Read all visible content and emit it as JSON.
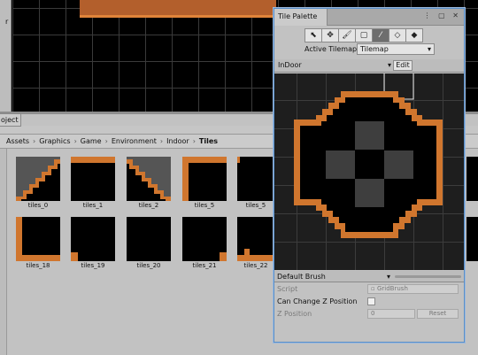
{
  "scene": {
    "left_label": "r"
  },
  "project": {
    "tab_label": "oject",
    "breadcrumb": [
      "Assets",
      "Graphics",
      "Game",
      "Environment",
      "Indoor",
      "Tiles"
    ],
    "tiles": [
      "tiles_0",
      "tiles_1",
      "tiles_2",
      "tiles_4",
      "tiles_5",
      "tiles_18",
      "tiles_19",
      "tiles_20",
      "tiles_21",
      "tiles_22"
    ]
  },
  "palette": {
    "tab_label": "Tile Palette",
    "window_icons": "⋮ ▢ ✕",
    "tools": [
      {
        "icon": "select-icon",
        "glyph": "⬉"
      },
      {
        "icon": "move-icon",
        "glyph": "✥"
      },
      {
        "icon": "paint-brush-icon",
        "glyph": "🖌"
      },
      {
        "icon": "box-fill-icon",
        "glyph": "▢"
      },
      {
        "icon": "picker-icon",
        "glyph": "⁄"
      },
      {
        "icon": "eraser-icon",
        "glyph": "◇"
      },
      {
        "icon": "fill-bucket-icon",
        "glyph": "◆"
      }
    ],
    "active_tool_index": 4,
    "active_tilemap_label": "Active Tilemap",
    "active_tilemap_value": "Tilemap",
    "palette_select": "InDoor",
    "edit_label": "Edit",
    "brush_select": "Default Brush",
    "props": {
      "script_label": "Script",
      "script_value": "GridBrush",
      "can_change_z_label": "Can Change Z Position",
      "z_position_label": "Z Position",
      "z_position_value": "0",
      "reset_label": "Reset"
    },
    "colors": {
      "accent": "#5a8fc8",
      "tile_orange": "#d0762e",
      "tile_grey": "#3c3c3c"
    }
  }
}
